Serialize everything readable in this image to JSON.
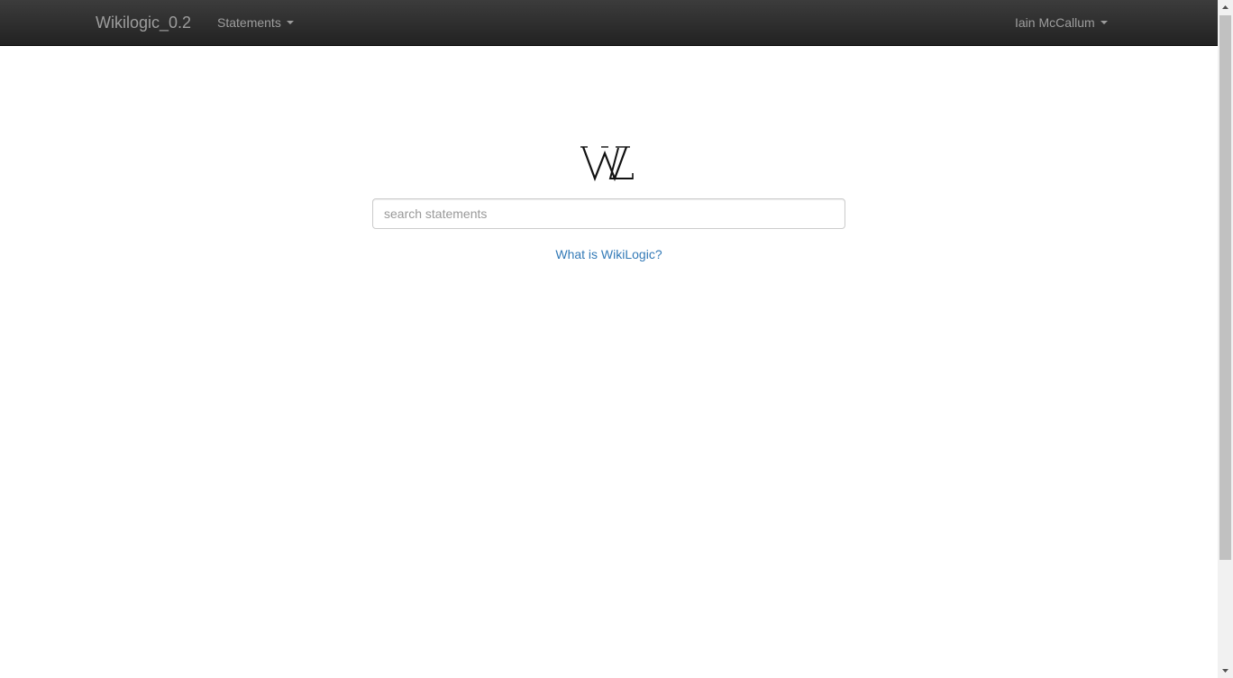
{
  "navbar": {
    "brand": "Wikilogic_0.2",
    "menu_statements": "Statements",
    "user_menu": "Iain McCallum",
    "caret_icon": "caret-down-icon"
  },
  "logo": {
    "text": "WL",
    "icon": "wikilogic-logo"
  },
  "search": {
    "placeholder": "search statements",
    "value": ""
  },
  "about": {
    "link_text": "What is WikiLogic?"
  },
  "colors": {
    "navbar_bg": "#222222",
    "nav_text": "#9d9d9d",
    "link": "#337ab7",
    "input_border": "#cccccc",
    "placeholder": "#999999"
  },
  "scrollbar": {
    "up_icon": "arrow-up-icon",
    "down_icon": "arrow-down-icon"
  }
}
